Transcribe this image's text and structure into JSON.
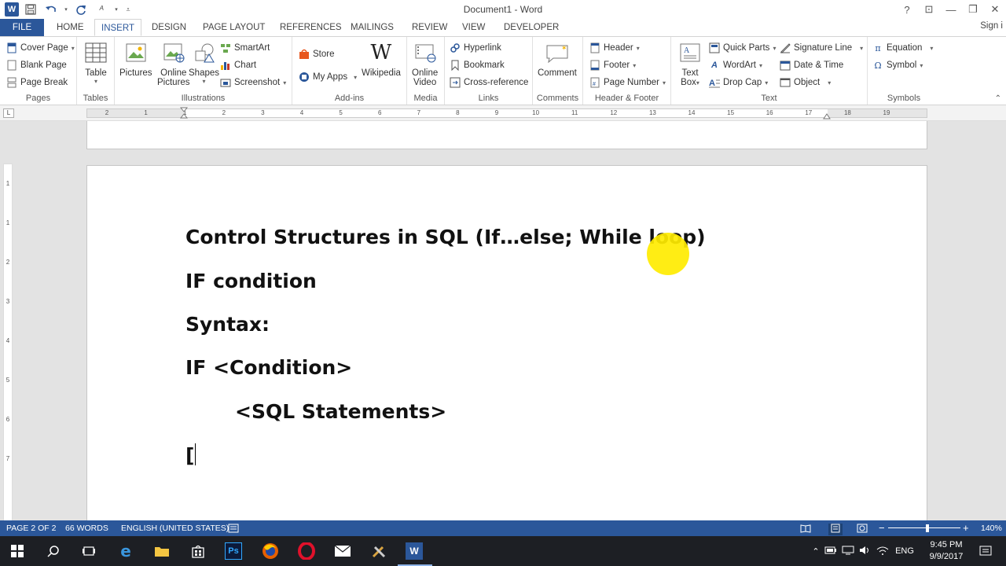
{
  "window": {
    "title": "Document1 - Word",
    "help": "?",
    "ribbon_display": "⊡",
    "minimize": "—",
    "restore": "❐",
    "close": "✕",
    "sign_in": "Sign i"
  },
  "qat": {
    "save": "💾",
    "undo": "↶",
    "redo": "↻",
    "format": "A",
    "customize": "▾"
  },
  "tabs": [
    "FILE",
    "HOME",
    "INSERT",
    "DESIGN",
    "PAGE LAYOUT",
    "REFERENCES",
    "MAILINGS",
    "REVIEW",
    "VIEW",
    "DEVELOPER"
  ],
  "active_tab": "INSERT",
  "ribbon": {
    "pages": {
      "label": "Pages",
      "cover_page": "Cover Page",
      "blank_page": "Blank Page",
      "page_break": "Page Break"
    },
    "tables": {
      "label": "Tables",
      "table": "Table"
    },
    "illustrations": {
      "label": "Illustrations",
      "pictures": "Pictures",
      "online_pictures_1": "Online",
      "online_pictures_2": "Pictures",
      "shapes": "Shapes",
      "smartart": "SmartArt",
      "chart": "Chart",
      "screenshot": "Screenshot"
    },
    "addins": {
      "label": "Add-ins",
      "store": "Store",
      "my_apps": "My Apps",
      "wikipedia": "Wikipedia"
    },
    "media": {
      "label": "Media",
      "online_video_1": "Online",
      "online_video_2": "Video"
    },
    "links": {
      "label": "Links",
      "hyperlink": "Hyperlink",
      "bookmark": "Bookmark",
      "cross_reference": "Cross-reference"
    },
    "comments": {
      "label": "Comments",
      "comment": "Comment"
    },
    "header_footer": {
      "label": "Header & Footer",
      "header": "Header",
      "footer": "Footer",
      "page_number": "Page Number"
    },
    "text": {
      "label": "Text",
      "text_box_1": "Text",
      "text_box_2": "Box",
      "quick_parts": "Quick Parts",
      "wordart": "WordArt",
      "drop_cap": "Drop Cap",
      "signature_line": "Signature Line",
      "date_time": "Date & Time",
      "object": "Object"
    },
    "symbols": {
      "label": "Symbols",
      "equation": "Equation",
      "symbol": "Symbol"
    }
  },
  "ruler": {
    "ticks": [
      "2",
      "1",
      "1",
      "2",
      "3",
      "4",
      "5",
      "6",
      "7",
      "8",
      "9",
      "10",
      "11",
      "12",
      "13",
      "14",
      "15",
      "16",
      "17",
      "18",
      "19"
    ],
    "vticks": [
      "1",
      "1",
      "2",
      "3",
      "4",
      "5",
      "6",
      "7"
    ],
    "tab_selector": "L"
  },
  "document": {
    "lines": [
      "Control Structures in SQL (If…else; While loop)",
      "IF condition",
      "Syntax:",
      "IF <Condition>",
      "<SQL Statements>",
      "["
    ]
  },
  "statusbar": {
    "page": "PAGE 2 OF 2",
    "words": "66 WORDS",
    "language": "ENGLISH (UNITED STATES)",
    "zoom_minus": "−",
    "zoom_plus": "+",
    "zoom": "140%"
  },
  "taskbar": {
    "lang": "ENG",
    "time": "9:45 PM",
    "date": "9/9/2017"
  },
  "colors": {
    "accent": "#2b579a",
    "cursor_highlight": "#ffeb00"
  }
}
